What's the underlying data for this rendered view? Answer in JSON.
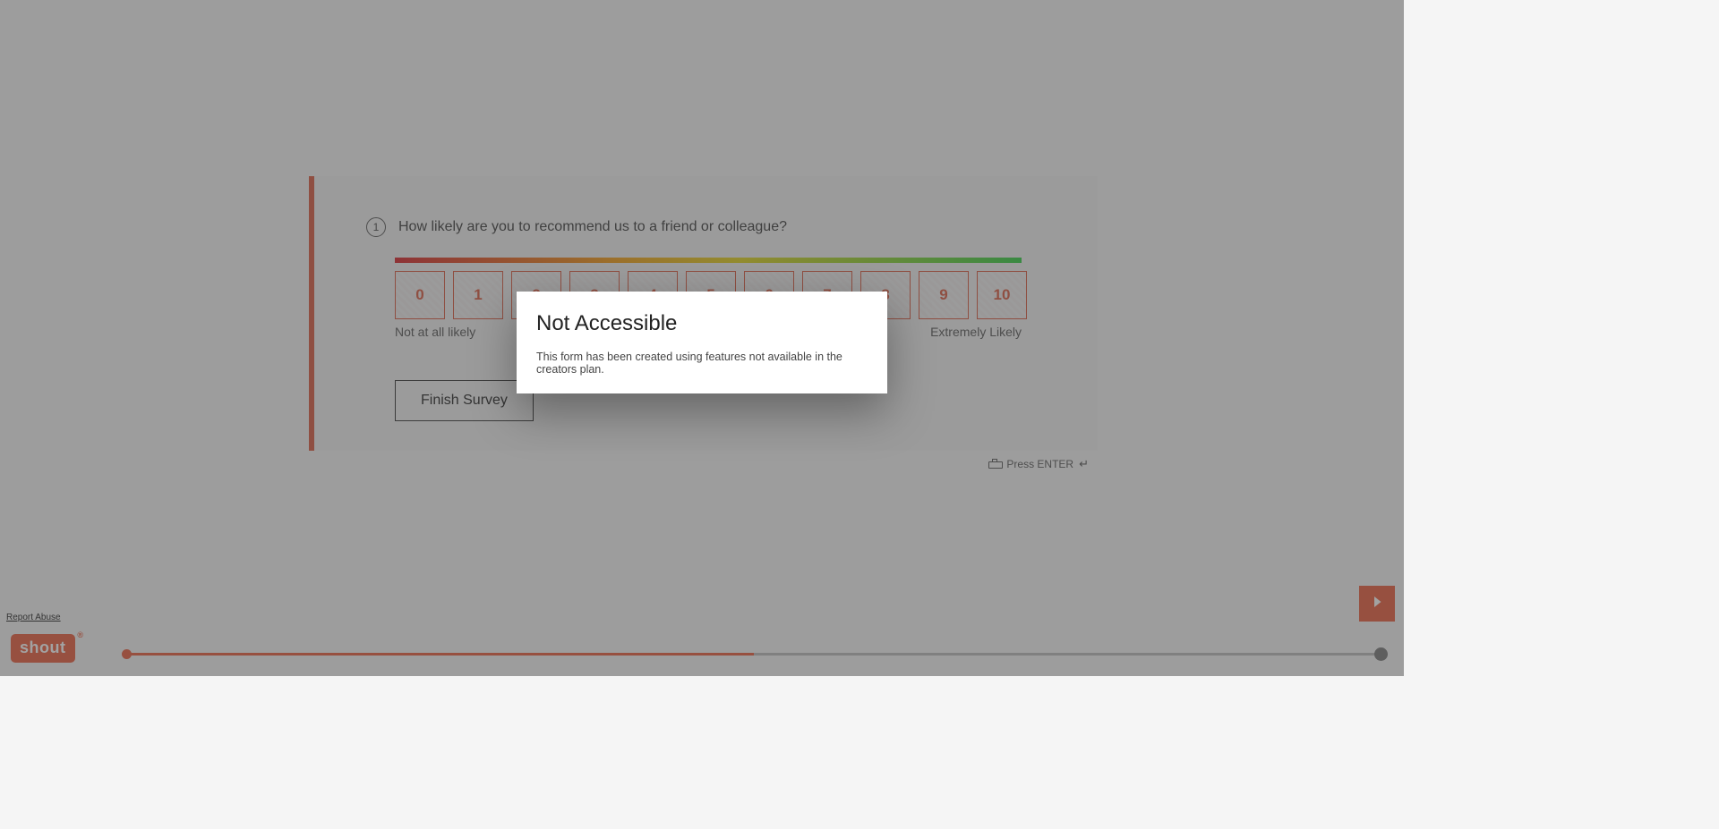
{
  "question": {
    "number": "1",
    "text": "How likely are you to recommend us to a friend or colleague?"
  },
  "nps": {
    "options": [
      "0",
      "1",
      "2",
      "3",
      "4",
      "5",
      "6",
      "7",
      "8",
      "9",
      "10"
    ],
    "low_label": "Not at all likely",
    "high_label": "Extremely Likely"
  },
  "finish_button": "Finish Survey",
  "hint": {
    "text": "Press ENTER",
    "enter_glyph": "↵"
  },
  "report_abuse": "Report Abuse",
  "logo": {
    "text": "shout",
    "reg": "®"
  },
  "progress": {
    "percent": 50
  },
  "modal": {
    "title": "Not Accessible",
    "body": "This form has been created using features not available in the creators plan."
  },
  "colors": {
    "accent": "#e85a3b"
  }
}
